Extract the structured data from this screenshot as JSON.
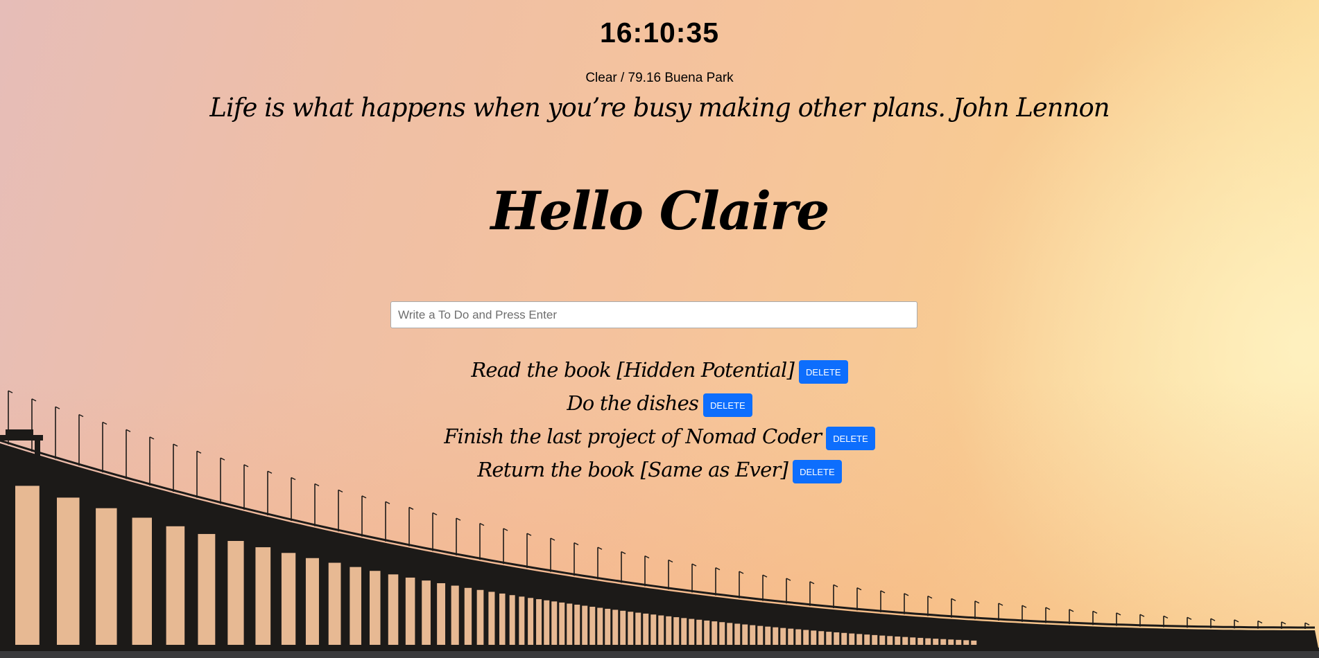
{
  "clock": {
    "time": "16:10:35"
  },
  "weather": {
    "text": "Clear / 79.16 Buena Park"
  },
  "quote": {
    "text": "Life is what happens when you’re busy making other plans. John Lennon"
  },
  "greeting": {
    "text": "Hello Claire"
  },
  "todo_form": {
    "placeholder": "Write a To Do and Press Enter",
    "value": ""
  },
  "todos": [
    {
      "text": "Read the book [Hidden Potential]",
      "delete_label": "DELETE"
    },
    {
      "text": "Do the dishes",
      "delete_label": "DELETE"
    },
    {
      "text": "Finish the last project of Nomad Coder",
      "delete_label": "DELETE"
    },
    {
      "text": "Return the book [Same as Ever]",
      "delete_label": "DELETE"
    }
  ],
  "colors": {
    "delete_button": "#0d6efd",
    "sky_left": "#e6bdb8",
    "sky_right": "#fde7a8",
    "bridge": "#1c1a18"
  },
  "background": {
    "scene": "sunset-bridge-photo"
  }
}
